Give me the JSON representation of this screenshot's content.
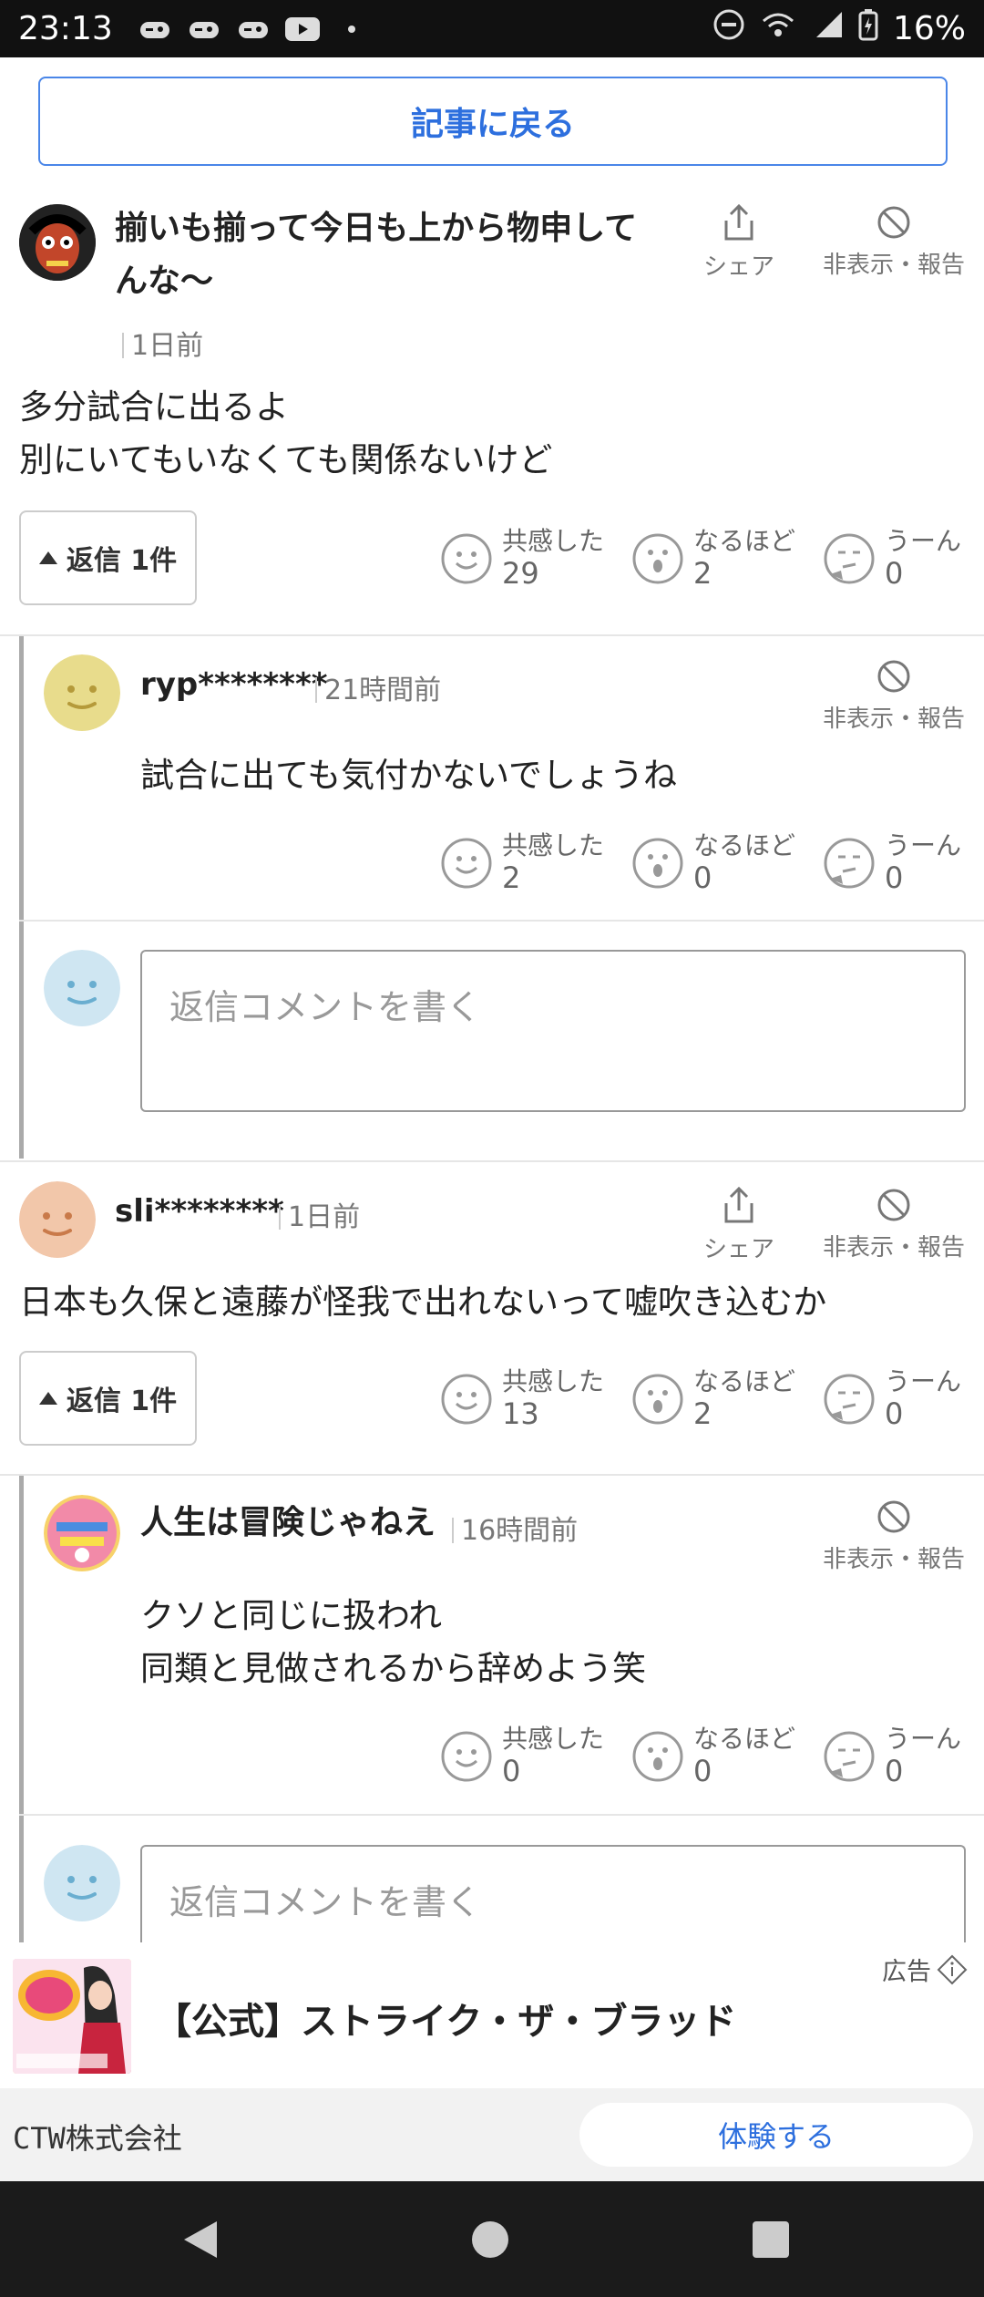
{
  "status_bar": {
    "time": "23:13",
    "battery": "16%",
    "net": "5"
  },
  "back_button": "記事に戻る",
  "labels": {
    "share": "シェア",
    "hide_report": "非表示・報告",
    "empathy": "共感した",
    "indeed": "なるほど",
    "hmm": "うーん",
    "reply_placeholder": "返信コメントを書く",
    "reply_count": "返信 1件"
  },
  "comments": [
    {
      "username": "揃いも揃って今日も上から物申してんな〜",
      "time": "1日前",
      "text": "多分試合に出るよ\n別にいてもいなくても関係ないけど",
      "reactions": {
        "empathy": "29",
        "indeed": "2",
        "hmm": "0"
      },
      "reply": {
        "username": "ryp********",
        "time": "21時間前",
        "text": "試合に出ても気付かないでしょうね",
        "reactions": {
          "empathy": "2",
          "indeed": "0",
          "hmm": "0"
        }
      }
    },
    {
      "username": "sli********",
      "time": "1日前",
      "text": "日本も久保と遠藤が怪我で出れないって嘘吹き込むか",
      "reactions": {
        "empathy": "13",
        "indeed": "2",
        "hmm": "0"
      },
      "reply": {
        "username": "人生は冒険じゃねえ",
        "time": "16時間前",
        "text": "クソと同じに扱われ\n同類と見做されるから辞めよう笑",
        "reactions": {
          "empathy": "0",
          "indeed": "0",
          "hmm": "0"
        }
      }
    }
  ],
  "ad": {
    "label": "広告",
    "title": "【公式】ストライク・ザ・ブラッド",
    "company": "CTW株式会社",
    "cta": "体験する"
  },
  "colors": {
    "accent": "#2d6fde",
    "face_yellow": "#e8dc8c",
    "face_blue": "#cfe6f2",
    "face_peach": "#f2c7aa"
  }
}
